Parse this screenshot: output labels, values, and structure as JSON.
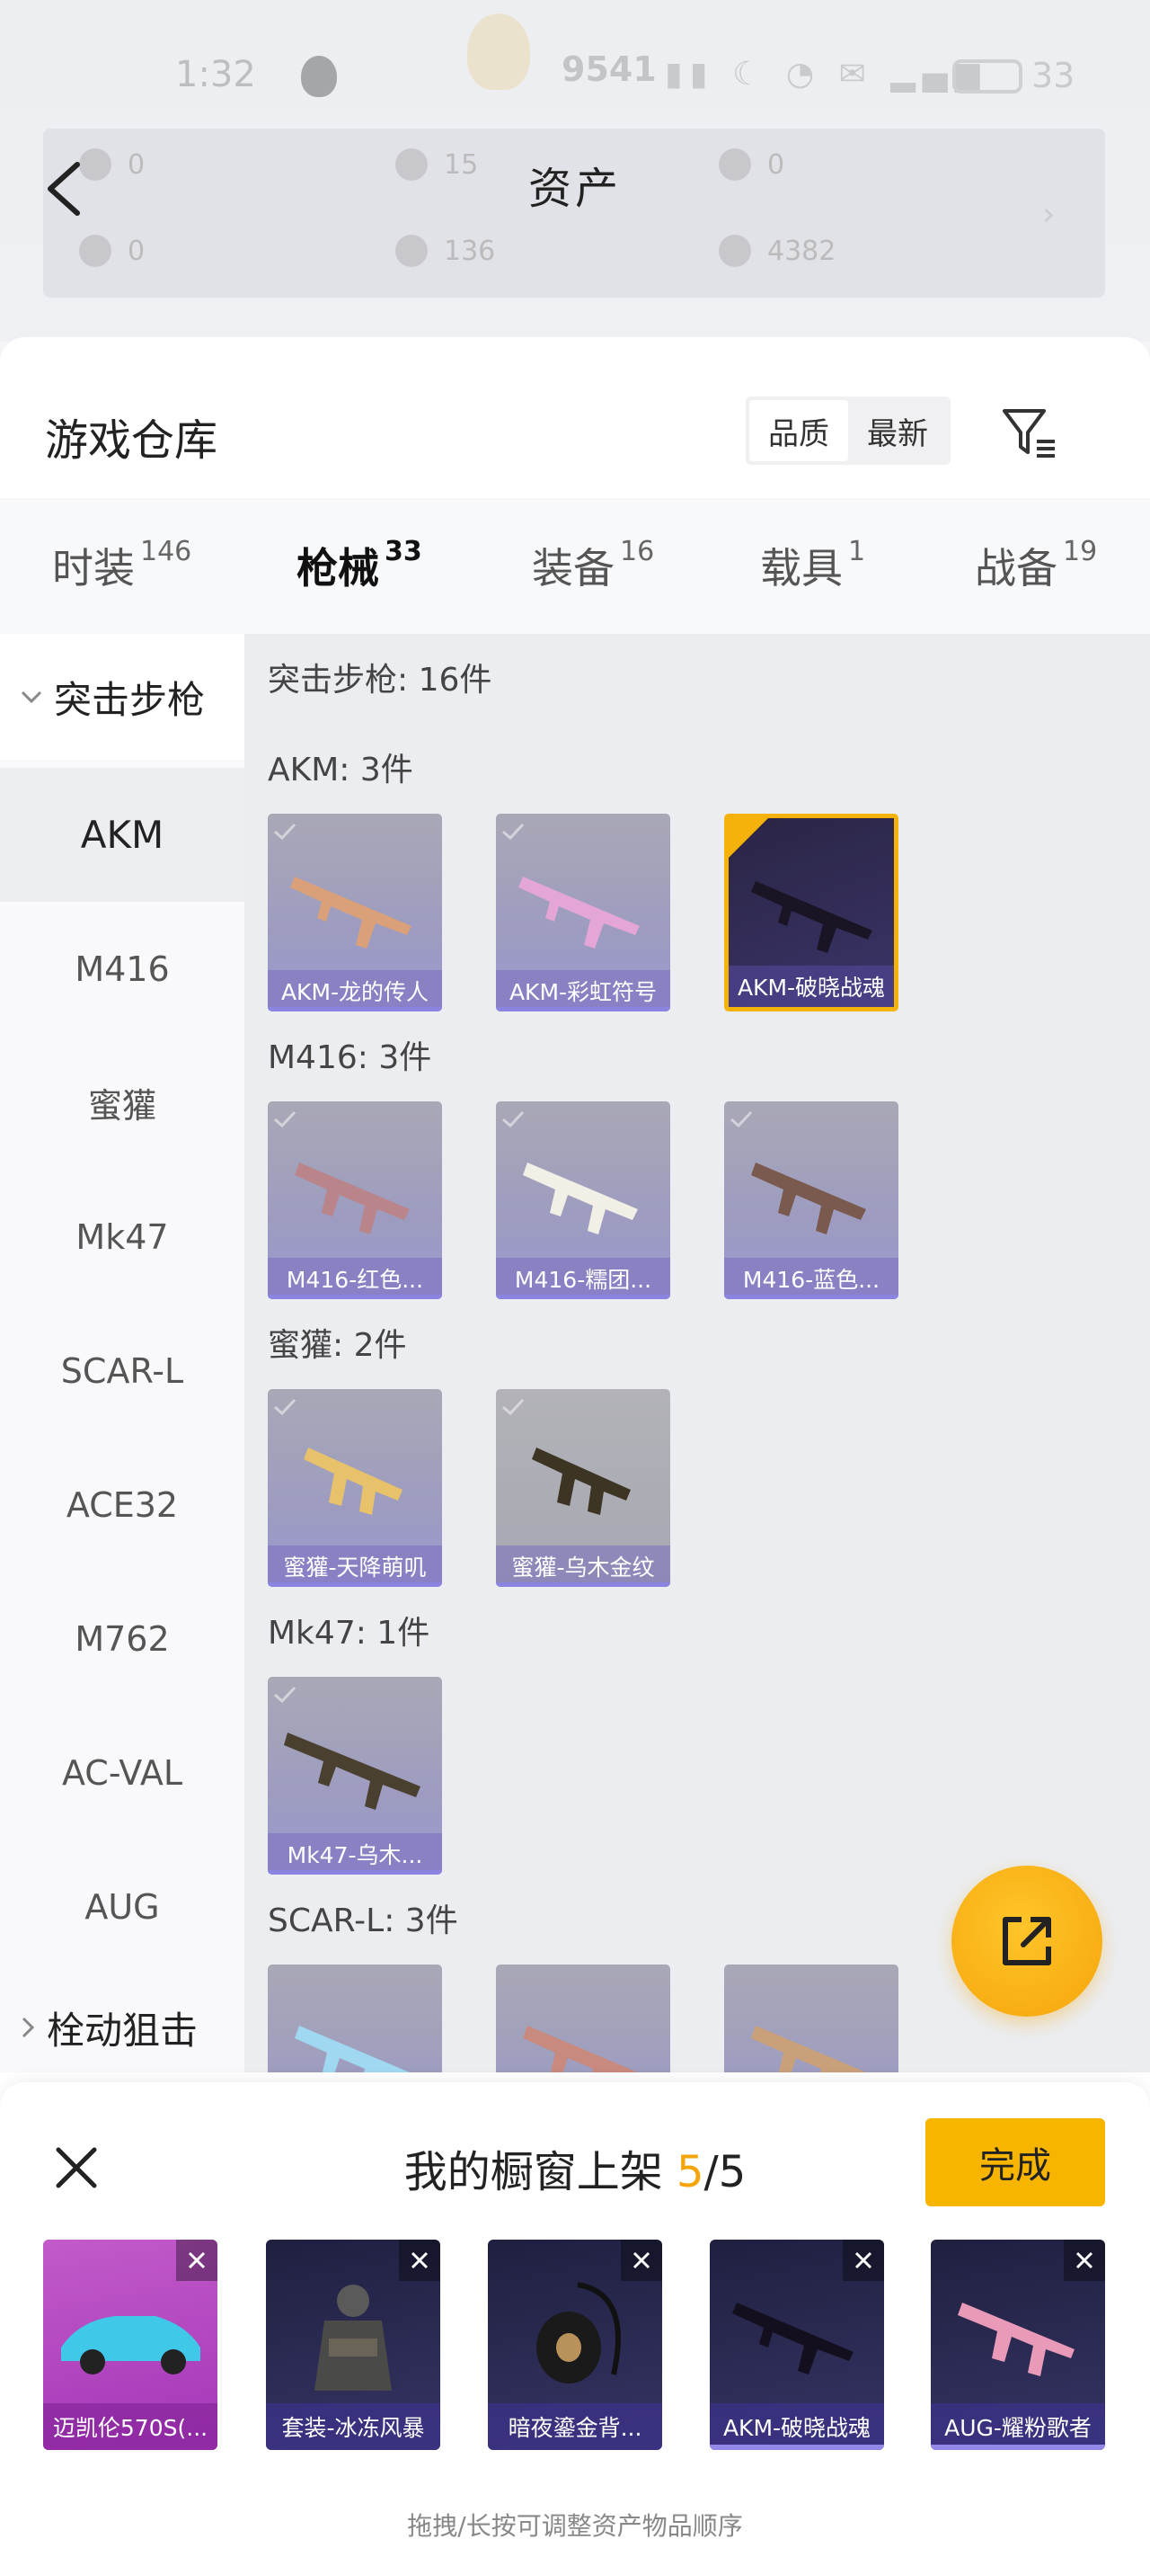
{
  "status_bar": {
    "time": "1:32",
    "score": "9541",
    "battery": "33"
  },
  "asset_header": {
    "title": "资产",
    "currencies": [
      "0",
      "15",
      "0",
      "0",
      "136",
      "4382"
    ]
  },
  "warehouse": {
    "title": "游戏仓库",
    "sort_options": [
      "品质",
      "最新"
    ],
    "active_sort": "品质"
  },
  "tabs": [
    {
      "label": "时装",
      "count": "146"
    },
    {
      "label": "枪械",
      "count": "33"
    },
    {
      "label": "装备",
      "count": "16"
    },
    {
      "label": "载具",
      "count": "1"
    },
    {
      "label": "战备",
      "count": "19"
    }
  ],
  "active_tab": "枪械",
  "sidebar": {
    "group_open": "突击步枪",
    "items": [
      "AKM",
      "M416",
      "蜜獾",
      "Mk47",
      "SCAR-L",
      "ACE32",
      "M762",
      "AC-VAL",
      "AUG"
    ],
    "group_closed": "栓动狙击"
  },
  "content": {
    "category_header": "突击步枪: 16件",
    "sections": [
      {
        "label": "AKM: 3件",
        "items": [
          "AKM-龙的传人",
          "AKM-彩虹符号",
          "AKM-破晓战魂"
        ]
      },
      {
        "label": "M416: 3件",
        "items": [
          "M416-红色...",
          "M416-糯团...",
          "M416-蓝色..."
        ]
      },
      {
        "label": "蜜獾: 2件",
        "items": [
          "蜜獾-天降萌叽",
          "蜜獾-乌木金纹"
        ]
      },
      {
        "label": "Mk47: 1件",
        "items": [
          "Mk47-乌木..."
        ]
      },
      {
        "label": "SCAR-L: 3件",
        "items": [
          "",
          "",
          ""
        ]
      }
    ],
    "selected_item": "AKM-破晓战魂"
  },
  "showcase": {
    "title": "我的橱窗上架",
    "current": "5",
    "total": "/5",
    "done_label": "完成",
    "slots": [
      "迈凯伦570S(...",
      "套装-冰冻风暴",
      "暗夜鎏金背...",
      "AKM-破晓战魂",
      "AUG-耀粉歌者"
    ],
    "hint": "拖拽/长按可调整资产物品顺序"
  },
  "colors": {
    "accent": "#f5a50a",
    "card_purple": "#9b97d0",
    "selected_border": "#f5b20a"
  }
}
